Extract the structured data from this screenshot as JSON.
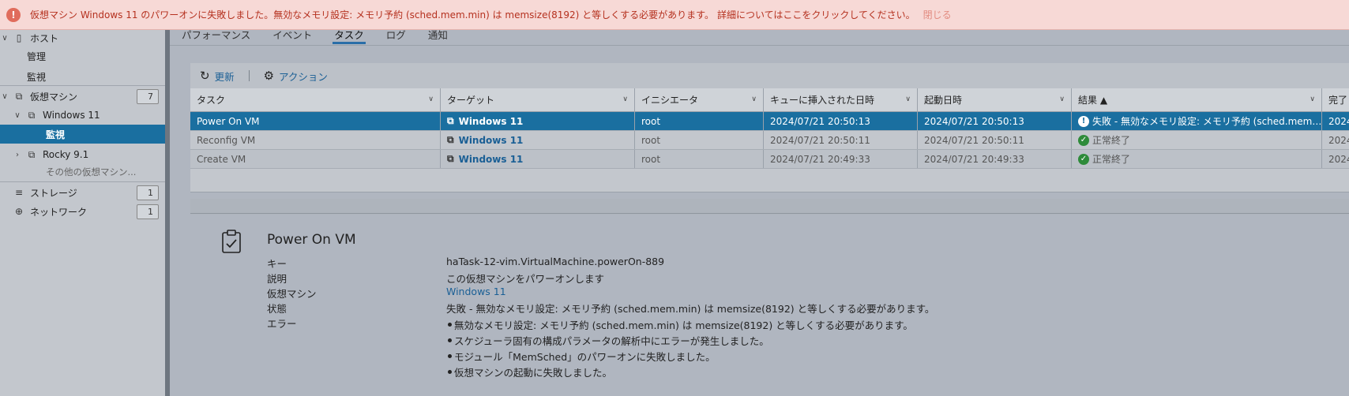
{
  "banner": {
    "message": "仮想マシン Windows 11 のパワーオンに失敗しました。無効なメモリ設定: メモリ予約 (sched.mem.min) は memsize(8192) と等しくする必要があります。",
    "details_link": "詳細についてはここをクリックしてください。",
    "close": "閉じる"
  },
  "sidebar": {
    "host": "ホスト",
    "manage": "管理",
    "monitor": "監視",
    "vms": "仮想マシン",
    "vms_count": "7",
    "windows11": "Windows 11",
    "selected_monitor": "監視",
    "rocky": "Rocky 9.1",
    "more_vms": "その他の仮想マシン...",
    "storage": "ストレージ",
    "storage_count": "1",
    "network": "ネットワーク",
    "network_count": "1"
  },
  "tabs": [
    "パフォーマンス",
    "イベント",
    "タスク",
    "ログ",
    "通知"
  ],
  "toolbar": {
    "refresh": "更新",
    "actions": "アクション"
  },
  "table": {
    "columns": [
      "タスク",
      "ターゲット",
      "イニシエータ",
      "キューに挿入された日時",
      "起動日時",
      "結果 ▲",
      "完了"
    ],
    "rows": [
      {
        "task": "Power On VM",
        "target": "Windows 11",
        "initiator": "root",
        "queued": "2024/07/21 20:50:13",
        "started": "2024/07/21 20:50:13",
        "result": "失敗 - 無効なメモリ設定: メモリ予約 (sched.mem…",
        "completed": "2024"
      },
      {
        "task": "Reconfig VM",
        "target": "Windows 11",
        "initiator": "root",
        "queued": "2024/07/21 20:50:11",
        "started": "2024/07/21 20:50:11",
        "result": "正常終了",
        "completed": "2024"
      },
      {
        "task": "Create VM",
        "target": "Windows 11",
        "initiator": "root",
        "queued": "2024/07/21 20:49:33",
        "started": "2024/07/21 20:49:33",
        "result": "正常終了",
        "completed": "2024"
      }
    ]
  },
  "details": {
    "title": "Power On VM",
    "labels": {
      "key": "キー",
      "description": "説明",
      "vm": "仮想マシン",
      "state": "状態",
      "error": "エラー"
    },
    "key": "haTask-12-vim.VirtualMachine.powerOn-889",
    "description": "この仮想マシンをパワーオンします",
    "vm": "Windows 11",
    "state": "失敗 - 無効なメモリ設定: メモリ予約 (sched.mem.min) は memsize(8192) と等しくする必要があります。",
    "errors": [
      "無効なメモリ設定: メモリ予約 (sched.mem.min) は memsize(8192) と等しくする必要があります。",
      "スケジューラ固有の構成パラメータの解析中にエラーが発生しました。",
      "モジュール「MemSched」のパワーオンに失敗しました。",
      "仮想マシンの起動に失敗しました。"
    ]
  }
}
